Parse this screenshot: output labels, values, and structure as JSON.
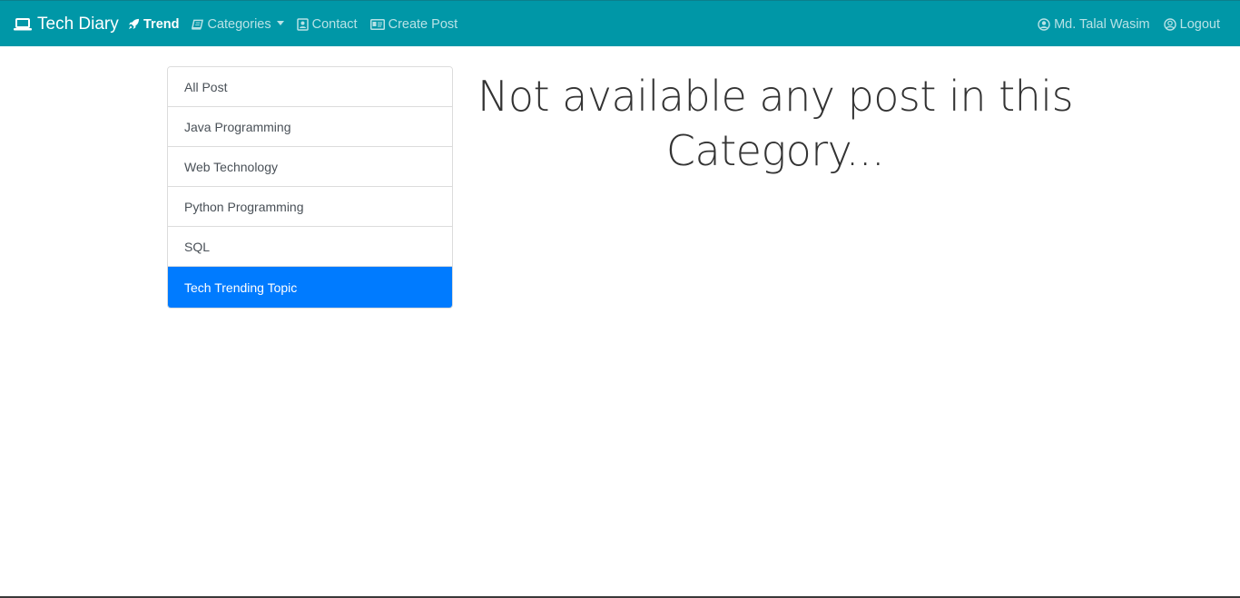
{
  "navbar": {
    "brand": {
      "label": "Tech Diary",
      "icon": "laptop-icon"
    },
    "left_items": [
      {
        "label": "Trend",
        "icon": "rocket-icon",
        "active": true
      },
      {
        "label": "Categories",
        "icon": "book-icon",
        "dropdown": true
      },
      {
        "label": "Contact",
        "icon": "address-book-icon"
      },
      {
        "label": "Create Post",
        "icon": "id-card-icon"
      }
    ],
    "right_items": [
      {
        "label": "Md. Talal Wasim",
        "icon": "user-circle-icon"
      },
      {
        "label": "Logout",
        "icon": "user-circle-icon"
      }
    ],
    "background": "#0097a7"
  },
  "sidebar": {
    "items": [
      {
        "label": "All Post",
        "active": false
      },
      {
        "label": "Java Programming",
        "active": false
      },
      {
        "label": "Web Technology",
        "active": false
      },
      {
        "label": "Python Programming",
        "active": false
      },
      {
        "label": "SQL",
        "active": false
      },
      {
        "label": "Tech Trending Topic",
        "active": true
      }
    ],
    "active_color": "#007bff"
  },
  "main": {
    "message_line1": "Not available any post in this",
    "message_line2": "Category..."
  }
}
